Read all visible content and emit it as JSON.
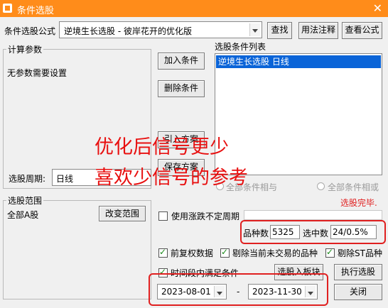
{
  "window": {
    "title": "条件选股",
    "close_glyph": "✕"
  },
  "formula": {
    "label": "条件选股公式",
    "value": "逆境生长选股 - 彼岸花开的优化版",
    "buttons": {
      "find": "查找",
      "usage": "用法注释",
      "view": "查看公式"
    }
  },
  "params": {
    "group_label": "计算参数",
    "message": "无参数需要设置"
  },
  "actions": {
    "add": "加入条件",
    "delete": "删除条件",
    "import": "引入方案",
    "save": "保存方案"
  },
  "conditions": {
    "label": "选股条件列表",
    "items": [
      "逆境生长选股  日线"
    ]
  },
  "period": {
    "label": "选股周期:",
    "value": "日线"
  },
  "logic": {
    "and_label": "全部条件相与",
    "or_label": "全部条件相或"
  },
  "status": {
    "done": "选股完毕."
  },
  "range": {
    "group_label": "选股范围",
    "value": "全部A股",
    "change_button": "改变范围"
  },
  "options": {
    "unfixed_period": "使用涨跌不定周期",
    "variety_label": "品种数",
    "variety_value": "5325",
    "selected_label": "选中数",
    "selected_value": "24/0.5%",
    "prev_adjust": "前复权数据",
    "exclude_untraded": "剔除当前未交易的品种",
    "exclude_st": "剔除ST品种",
    "time_range": "时间段内满足条件"
  },
  "buttons": {
    "to_board": "选股入板块",
    "execute": "执行选股",
    "close": "关闭"
  },
  "dates": {
    "start": "2023-08-01",
    "separator": "-",
    "end": "2023-11-30"
  },
  "annotation": {
    "line1": "优化后信号更少",
    "line2": "喜欢少信号的参考"
  },
  "colors": {
    "title_bar": "#ff8c1a",
    "selection": "#0a64d8",
    "annotation": "#e81010"
  }
}
